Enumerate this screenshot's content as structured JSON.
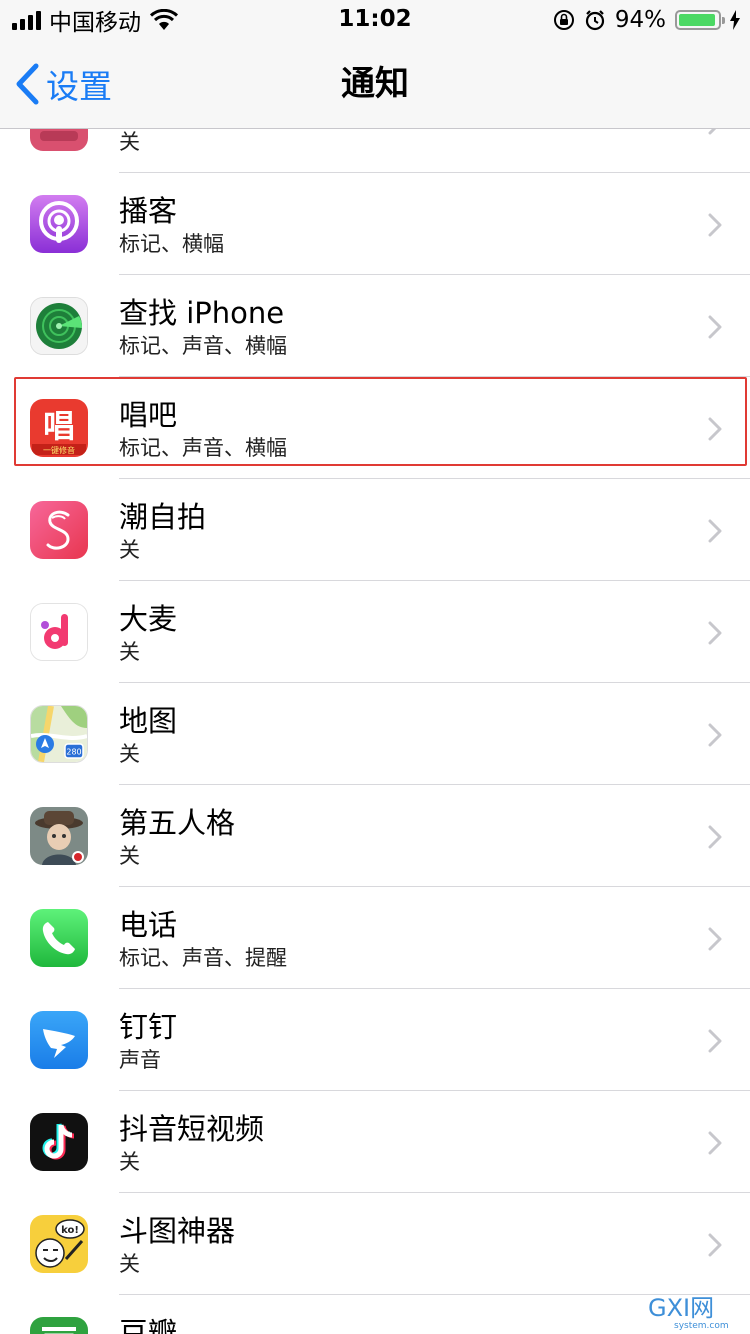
{
  "status_bar": {
    "carrier": "中国移动",
    "time": "11:02",
    "battery_percent": "94%",
    "battery_level": 0.94
  },
  "nav": {
    "back_label": "设置",
    "title": "通知"
  },
  "apps": [
    {
      "name": "",
      "status": "关",
      "icon": "pink-app-icon"
    },
    {
      "name": "播客",
      "status": "标记、横幅",
      "icon": "podcasts-icon"
    },
    {
      "name": "查找 iPhone",
      "status": "标记、声音、横幅",
      "icon": "find-iphone-icon"
    },
    {
      "name": "唱吧",
      "status": "标记、声音、横幅",
      "icon": "changba-icon"
    },
    {
      "name": "潮自拍",
      "status": "关",
      "icon": "chaozipai-icon"
    },
    {
      "name": "大麦",
      "status": "关",
      "icon": "damai-icon"
    },
    {
      "name": "地图",
      "status": "关",
      "icon": "maps-icon"
    },
    {
      "name": "第五人格",
      "status": "关",
      "icon": "identity-v-icon"
    },
    {
      "name": "电话",
      "status": "标记、声音、提醒",
      "icon": "phone-icon"
    },
    {
      "name": "钉钉",
      "status": "声音",
      "icon": "dingtalk-icon"
    },
    {
      "name": "抖音短视频",
      "status": "关",
      "icon": "douyin-icon"
    },
    {
      "name": "斗图神器",
      "status": "关",
      "icon": "doutu-icon"
    },
    {
      "name": "豆瓣",
      "status": "",
      "icon": "douban-icon"
    }
  ],
  "icon_text": {
    "changba_char": "唱",
    "changba_banner": "一键修音",
    "maps_badge": "280",
    "doutu_bubble": "ko!"
  },
  "watermark": {
    "logo": "GXI网",
    "domain": "system.com"
  },
  "colors": {
    "accent": "#1a7cf5",
    "highlight": "#e03a34",
    "battery": "#4cd964"
  }
}
